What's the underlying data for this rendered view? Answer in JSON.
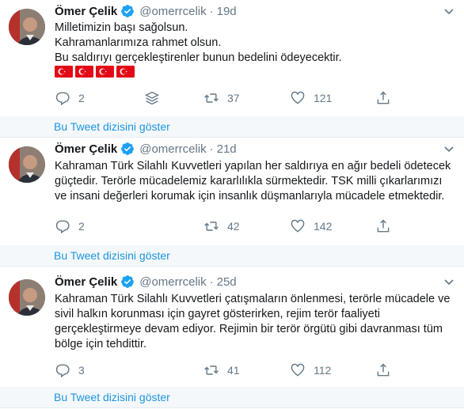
{
  "tweets": [
    {
      "name": "Ömer Çelik",
      "handle": "@omerrcelik",
      "dot": "·",
      "time": "19d",
      "text": "Milletimizin başı sağolsun.\nKahramanlarımıza rahmet olsun.\nBu saldırıyı gerçekleştirenler bunun bedelini ödeyecektir.",
      "flags": [
        "turkey-flag",
        "turkey-flag",
        "turkey-flag",
        "turkey-flag"
      ],
      "replies": "2",
      "retweets": "37",
      "likes": "121"
    },
    {
      "name": "Ömer Çelik",
      "handle": "@omerrcelik",
      "dot": "·",
      "time": "21d",
      "text": "Kahraman Türk Silahlı Kuvvetleri yapılan her saldırıya en ağır bedeli ödetecek güçtedir. Terörle mücadelemiz kararlılıkla sürmektedir. TSK milli çıkarlarımızı ve insani değerleri korumak için insanlık düşmanlarıyla mücadele etmektedir.",
      "replies": "2",
      "retweets": "42",
      "likes": "142"
    },
    {
      "name": "Ömer Çelik",
      "handle": "@omerrcelik",
      "dot": "·",
      "time": "25d",
      "text": "Kahraman Türk Silahlı Kuvvetleri çatışmaların önlenmesi, terörle mücadele ve sivil halkın korunması için gayret gösterirken, rejim terör faaliyeti gerçekleştirmeye devam ediyor. Rejimin bir terör örgütü gibi davranması tüm bölge için tehdittir.",
      "replies": "3",
      "retweets": "41",
      "likes": "112"
    }
  ],
  "thread_link": "Bu Tweet dizisini göster",
  "colors": {
    "link": "#1b95e0",
    "secondary": "#657786",
    "verified": "#1da1f2",
    "thread_bg": "#f5f8fa",
    "flag_red": "#e30a17"
  },
  "icons": [
    "verified-badge-icon",
    "chevron-down-icon",
    "reply-icon",
    "stack-icon",
    "retweet-icon",
    "like-icon",
    "share-icon"
  ]
}
